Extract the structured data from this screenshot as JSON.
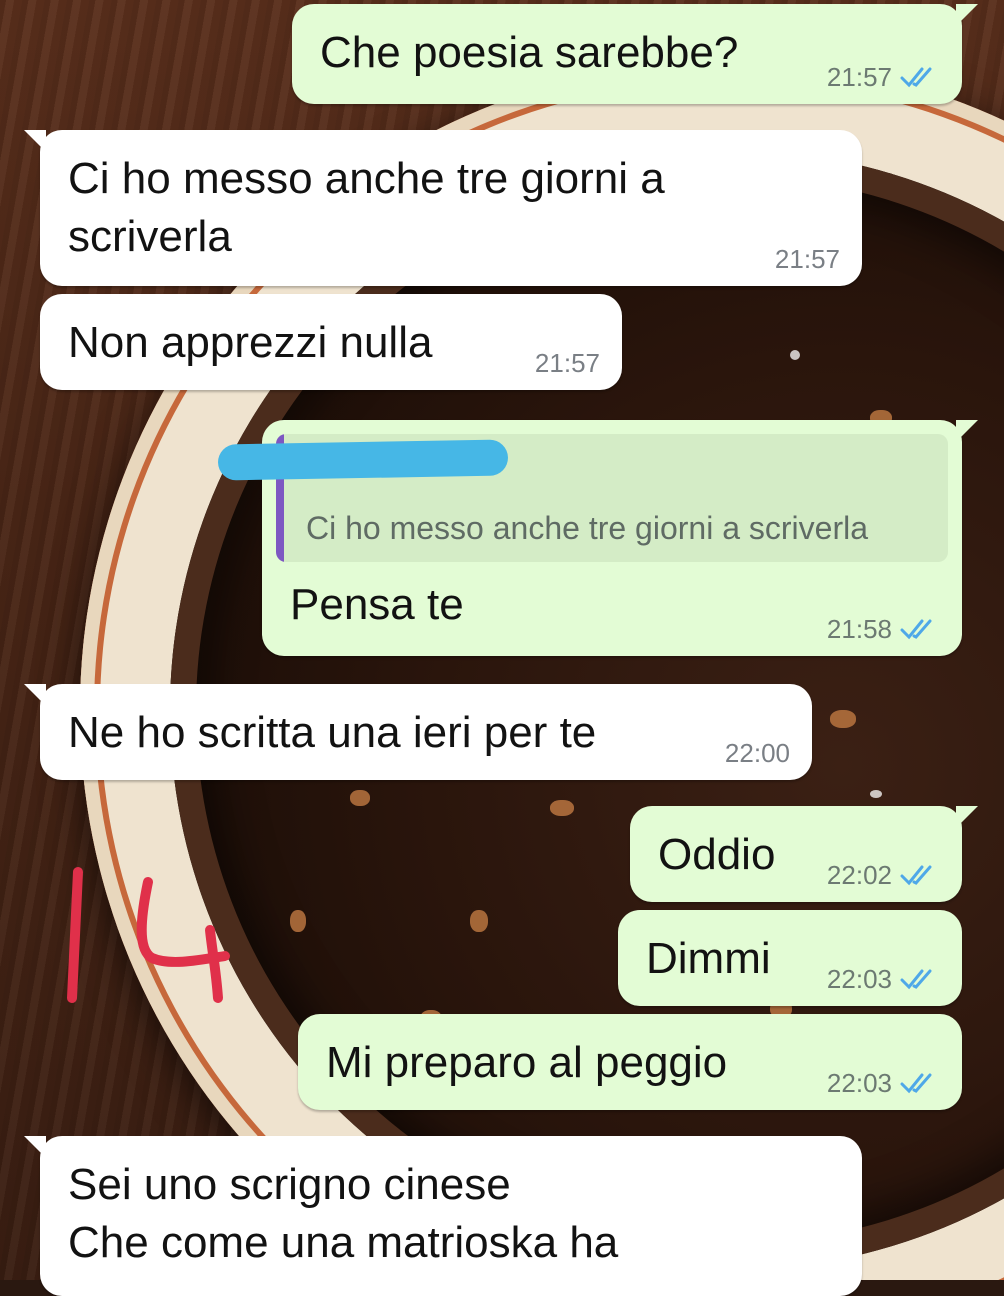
{
  "colors": {
    "outgoing_bubble": "#e3fcd5",
    "incoming_bubble": "#ffffff",
    "read_ticks": "#4fa8e8",
    "quote_bar": "#7d57c2",
    "redaction": "#46b7e6",
    "annotation_mark": "#e0304a"
  },
  "annotation": {
    "text": "14"
  },
  "messages": [
    {
      "direction": "outgoing",
      "text": "Che poesia sarebbe?",
      "time": "21:57",
      "status": "read-double-check-icon"
    },
    {
      "direction": "incoming",
      "text": "Ci ho messo anche tre giorni a\nscriverla",
      "time": "21:57"
    },
    {
      "direction": "incoming",
      "text": "Non apprezzi nulla",
      "time": "21:57"
    },
    {
      "direction": "outgoing",
      "quoted_text": "Ci ho messo anche tre giorni a scriverla",
      "quoted_author_redacted": true,
      "text": "Pensa te",
      "time": "21:58",
      "status": "read-double-check-icon"
    },
    {
      "direction": "incoming",
      "text": "Ne ho scritta una ieri per te",
      "time": "22:00"
    },
    {
      "direction": "outgoing",
      "text": "Oddio",
      "time": "22:02",
      "status": "read-double-check-icon"
    },
    {
      "direction": "outgoing",
      "text": "Dimmi",
      "time": "22:03",
      "status": "read-double-check-icon"
    },
    {
      "direction": "outgoing",
      "text": "Mi preparo al peggio",
      "time": "22:03",
      "status": "read-double-check-icon"
    },
    {
      "direction": "incoming",
      "text": "Sei uno scrigno cinese\nChe come una matrioska ha"
    }
  ]
}
